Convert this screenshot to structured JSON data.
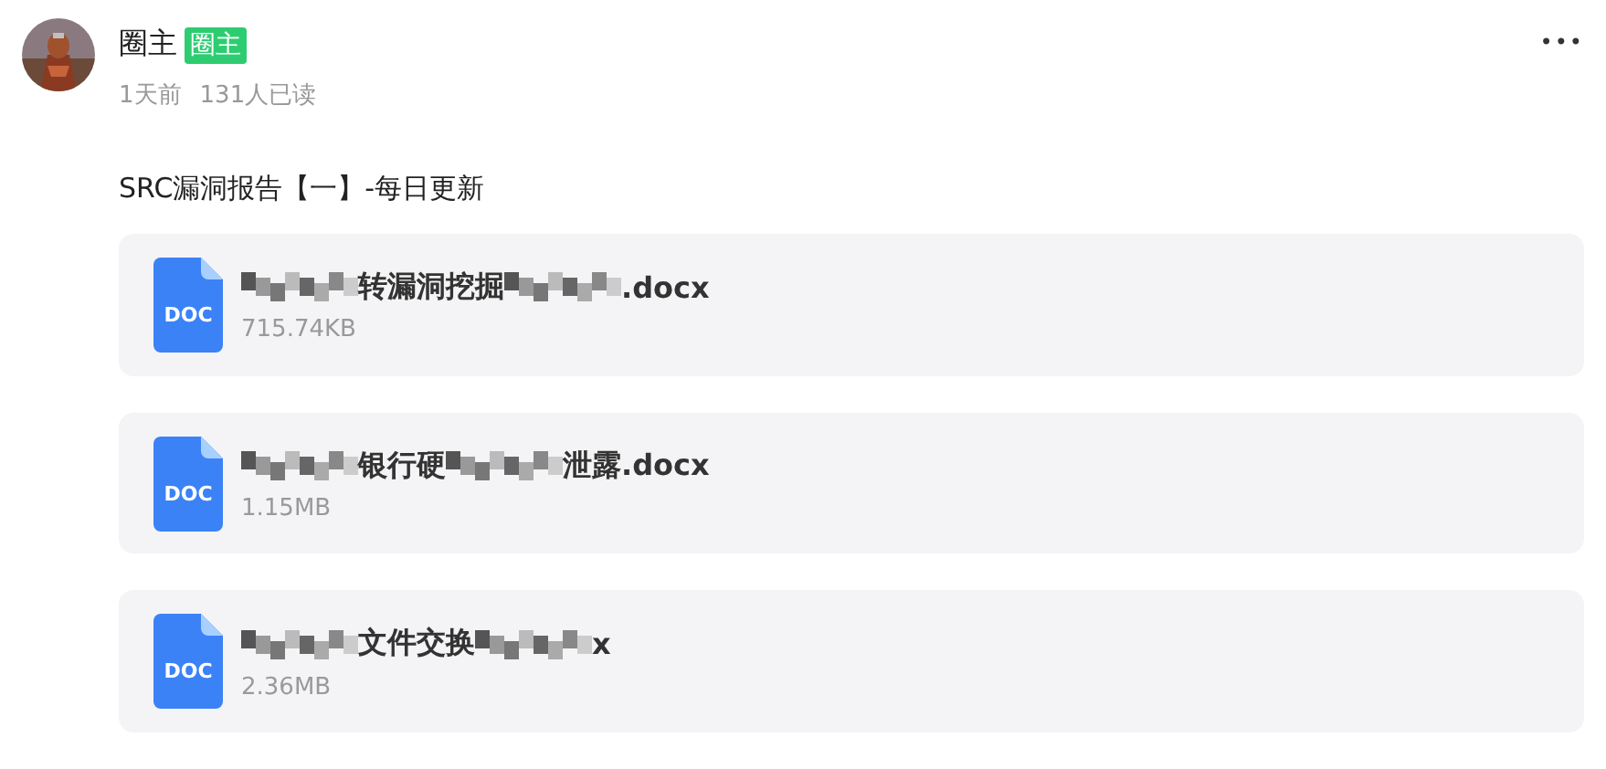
{
  "author": {
    "name": "圈主",
    "badge": "圈主",
    "kind": "picture"
  },
  "meta": {
    "time": "1天前",
    "reads": "131人已读"
  },
  "more": "•••",
  "title": "SRC漏洞报告【一】-每日更新",
  "files": [
    {
      "type": "DOC",
      "size": "715.74KB",
      "name_parts": [
        {
          "kind": "redacted"
        },
        {
          "kind": "text",
          "text": "转漏洞挖掘"
        },
        {
          "kind": "redacted"
        },
        {
          "kind": "text",
          "text": ".docx"
        }
      ]
    },
    {
      "type": "DOC",
      "size": "1.15MB",
      "name_parts": [
        {
          "kind": "redacted"
        },
        {
          "kind": "text",
          "text": "银行硬"
        },
        {
          "kind": "redacted"
        },
        {
          "kind": "text",
          "text": "泄露.docx"
        }
      ]
    },
    {
      "type": "DOC",
      "size": "2.36MB",
      "name_parts": [
        {
          "kind": "redacted"
        },
        {
          "kind": "text",
          "text": "文件交换"
        },
        {
          "kind": "redacted"
        },
        {
          "kind": "text",
          "text": "x"
        }
      ]
    }
  ]
}
